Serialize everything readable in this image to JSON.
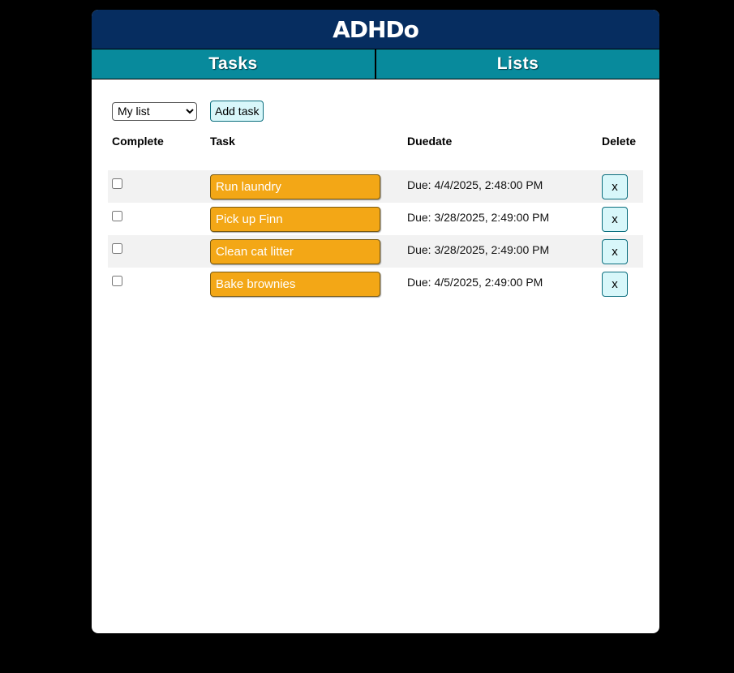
{
  "app": {
    "title": "ADHDo"
  },
  "tabs": [
    {
      "label": "Tasks"
    },
    {
      "label": "Lists"
    }
  ],
  "controls": {
    "list_selected": "My list",
    "add_task_label": "Add task"
  },
  "table": {
    "headers": {
      "complete": "Complete",
      "task": "Task",
      "duedate": "Duedate",
      "delete": "Delete"
    },
    "rows": [
      {
        "task": "Run laundry",
        "due": "Due: 4/4/2025, 2:48:00 PM",
        "delete": "x",
        "completed": false
      },
      {
        "task": "Pick up Finn",
        "due": "Due: 3/28/2025, 2:49:00 PM",
        "delete": "x",
        "completed": false
      },
      {
        "task": "Clean cat litter",
        "due": "Due: 3/28/2025, 2:49:00 PM",
        "delete": "x",
        "completed": false
      },
      {
        "task": "Bake brownies",
        "due": "Due: 4/5/2025, 2:49:00 PM",
        "delete": "x",
        "completed": false
      }
    ]
  },
  "colors": {
    "header_bg": "#062d60",
    "tab_bg": "#088a9c",
    "task_button": "#f3a716",
    "action_button": "#d8f7fa",
    "page_bg": "#000000"
  }
}
